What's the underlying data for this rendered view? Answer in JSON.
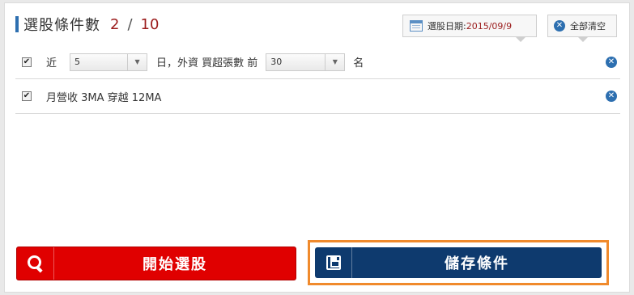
{
  "header": {
    "title": "選股條件數",
    "count": "2",
    "separator": "/",
    "max": "10",
    "date_label": "選股日期:",
    "date_value": "2015/09/9",
    "clear_label": "全部清空"
  },
  "conditions": [
    {
      "checked": true,
      "prefix": "近",
      "days_value": "5",
      "middle": "日，外資 買超張數 前",
      "rank_value": "30",
      "suffix": "名"
    },
    {
      "checked": true,
      "text": "月營收 3MA 穿越 12MA"
    }
  ],
  "buttons": {
    "start_label": "開始選股",
    "save_label": "儲存條件"
  },
  "icons": {
    "calendar": "calendar-icon",
    "clear": "close-circle-icon",
    "remove": "close-circle-icon",
    "search": "search-icon",
    "save": "save-icon"
  },
  "colors": {
    "accent_blue": "#2d6fb0",
    "count_red": "#9b1b1b",
    "start_button": "#e00000",
    "save_button": "#0e3a6e",
    "highlight_orange": "#f08a2c"
  }
}
